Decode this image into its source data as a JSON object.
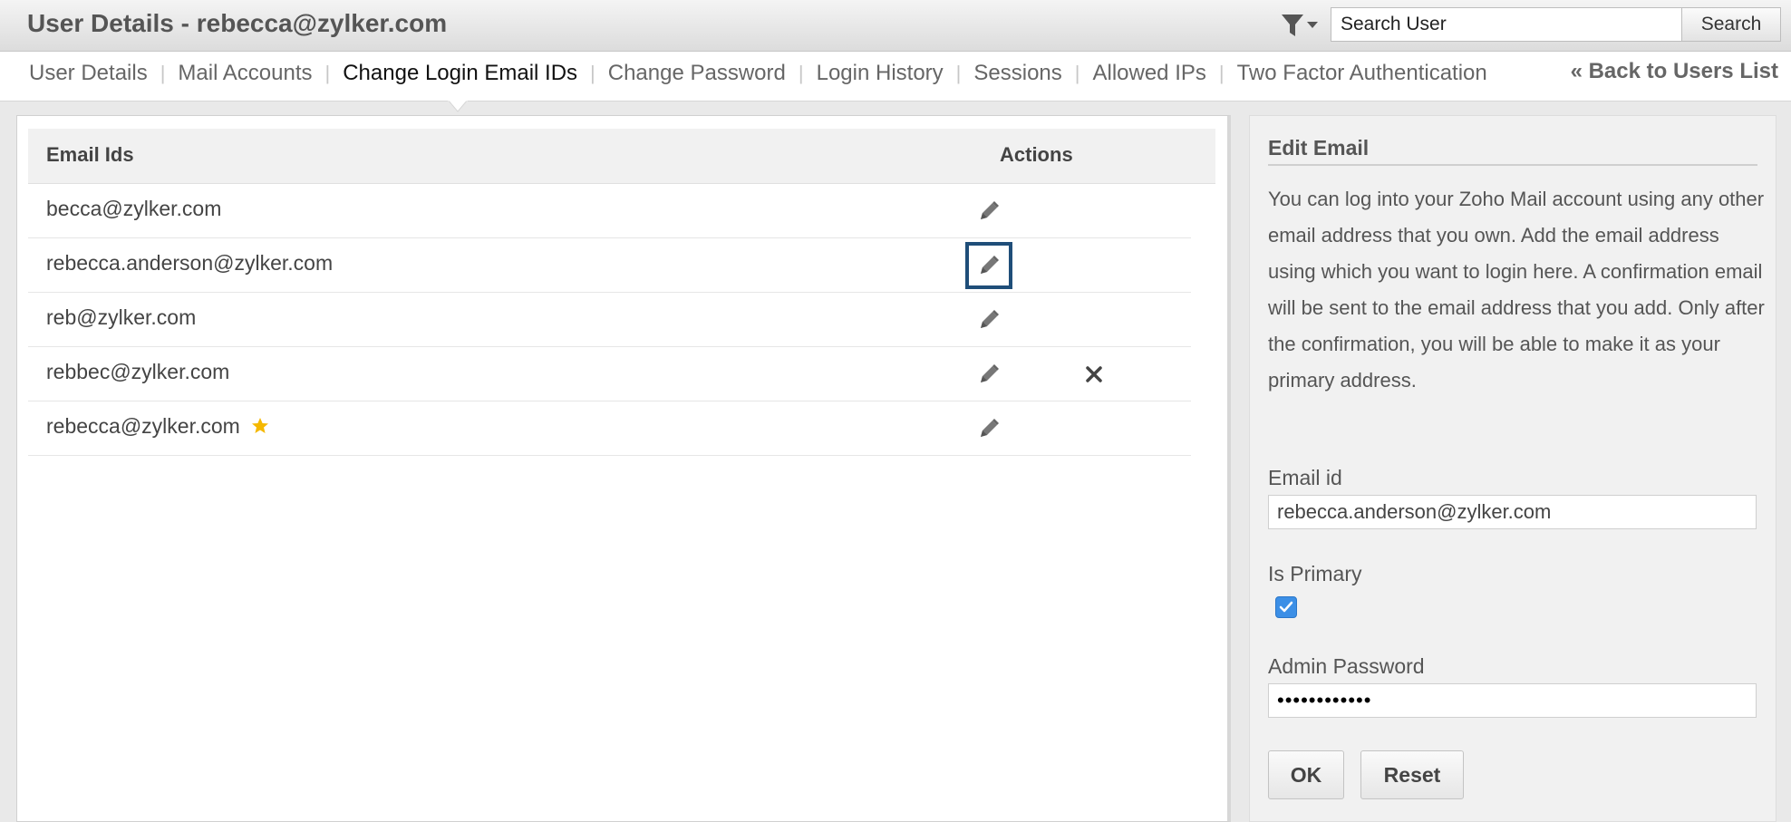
{
  "header": {
    "title": "User Details - rebecca@zylker.com",
    "filter_icon": "filter-dropdown-icon",
    "search_placeholder": "Search User",
    "search_button": "Search"
  },
  "tabs": [
    {
      "label": "User Details",
      "active": false
    },
    {
      "label": "Mail Accounts",
      "active": false
    },
    {
      "label": "Change Login Email IDs",
      "active": true
    },
    {
      "label": "Change Password",
      "active": false
    },
    {
      "label": "Login History",
      "active": false
    },
    {
      "label": "Sessions",
      "active": false
    },
    {
      "label": "Allowed IPs",
      "active": false
    },
    {
      "label": "Two Factor Authentication",
      "active": false
    }
  ],
  "back_link": "« Back to Users List",
  "table": {
    "col_email": "Email Ids",
    "col_actions": "Actions",
    "rows": [
      {
        "email": "becca@zylker.com"
      },
      {
        "email": "rebecca.anderson@zylker.com"
      },
      {
        "email": "reb@zylker.com"
      },
      {
        "email": "rebbec@zylker.com"
      },
      {
        "email": "rebecca@zylker.com"
      }
    ]
  },
  "edit_panel": {
    "title": "Edit Email",
    "description": "You can log into your Zoho Mail account using any other email address that you own. Add the email address using which you want to login here. A confirmation email will be sent to the email address that you add. Only after the confirmation, you will be able to make it as your primary address.",
    "email_label": "Email id",
    "email_value": "rebecca.anderson@zylker.com",
    "primary_label": "Is Primary",
    "is_primary": true,
    "password_label": "Admin Password",
    "password_value": "••••••••••••",
    "ok_button": "OK",
    "reset_button": "Reset"
  },
  "colors": {
    "focus_outline": "#1f4e79",
    "checkbox": "#3c8fe6",
    "star": "#f5b800"
  }
}
